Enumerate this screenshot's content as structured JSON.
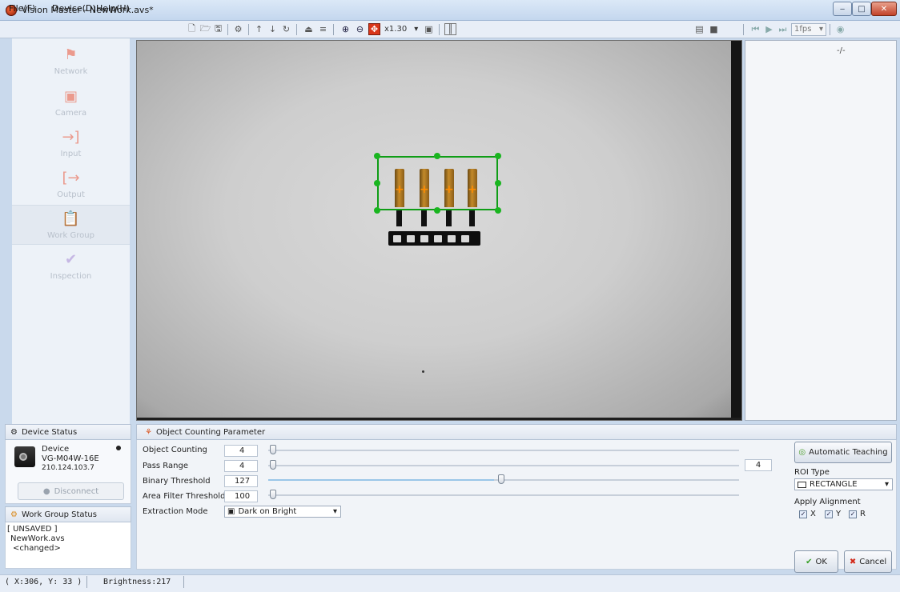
{
  "window": {
    "title": "Vision Master - NewWork.avs*"
  },
  "menu": {
    "file": "File(F)",
    "device": "Device(D)",
    "help": "Help(H)"
  },
  "toolbar": {
    "zoom": "x1.30",
    "fps": "1fps"
  },
  "nav": {
    "items": [
      {
        "label": "Network",
        "icon": "network-icon"
      },
      {
        "label": "Camera",
        "icon": "camera-icon"
      },
      {
        "label": "Input",
        "icon": "input-icon"
      },
      {
        "label": "Output",
        "icon": "output-icon"
      },
      {
        "label": "Work Group",
        "icon": "work-group-icon"
      },
      {
        "label": "Inspection",
        "icon": "inspection-icon"
      }
    ],
    "active_index": 4
  },
  "viewer": {
    "side_status": "-/-"
  },
  "device_status": {
    "title": "Device Status",
    "device_label": "Device",
    "model": "VG-M04W-16E",
    "ip": "210.124.103.7",
    "disconnect_label": "Disconnect"
  },
  "work_group_status": {
    "title": "Work Group Status",
    "state": "[ UNSAVED ]",
    "file": "NewWork.avs",
    "changed": "<changed>"
  },
  "params": {
    "title": "Object Counting Parameter",
    "object_counting": {
      "label": "Object Counting",
      "value": "4",
      "slider_fraction": 0.0
    },
    "pass_range": {
      "label": "Pass Range",
      "value": "4",
      "upper": "4",
      "slider_fraction": 0.0
    },
    "binary_threshold": {
      "label": "Binary Threshold",
      "value": "127",
      "slider_fraction": 0.5
    },
    "area_filter": {
      "label": "Area Filter Threshold",
      "value": "100",
      "slider_fraction": 0.0
    },
    "extraction_mode": {
      "label": "Extraction Mode",
      "value": "Dark on Bright"
    },
    "auto_teaching_label": "Automatic Teaching",
    "roi_type": {
      "label": "ROI Type",
      "value": "RECTANGLE"
    },
    "apply_alignment": {
      "label": "Apply Alignment",
      "x": "X",
      "y": "Y",
      "r": "R",
      "x_checked": true,
      "y_checked": true,
      "r_checked": true
    },
    "ok_label": "OK",
    "cancel_label": "Cancel"
  },
  "status_bar": {
    "coords": "( X:306, Y: 33 )",
    "brightness": "Brightness:217"
  }
}
